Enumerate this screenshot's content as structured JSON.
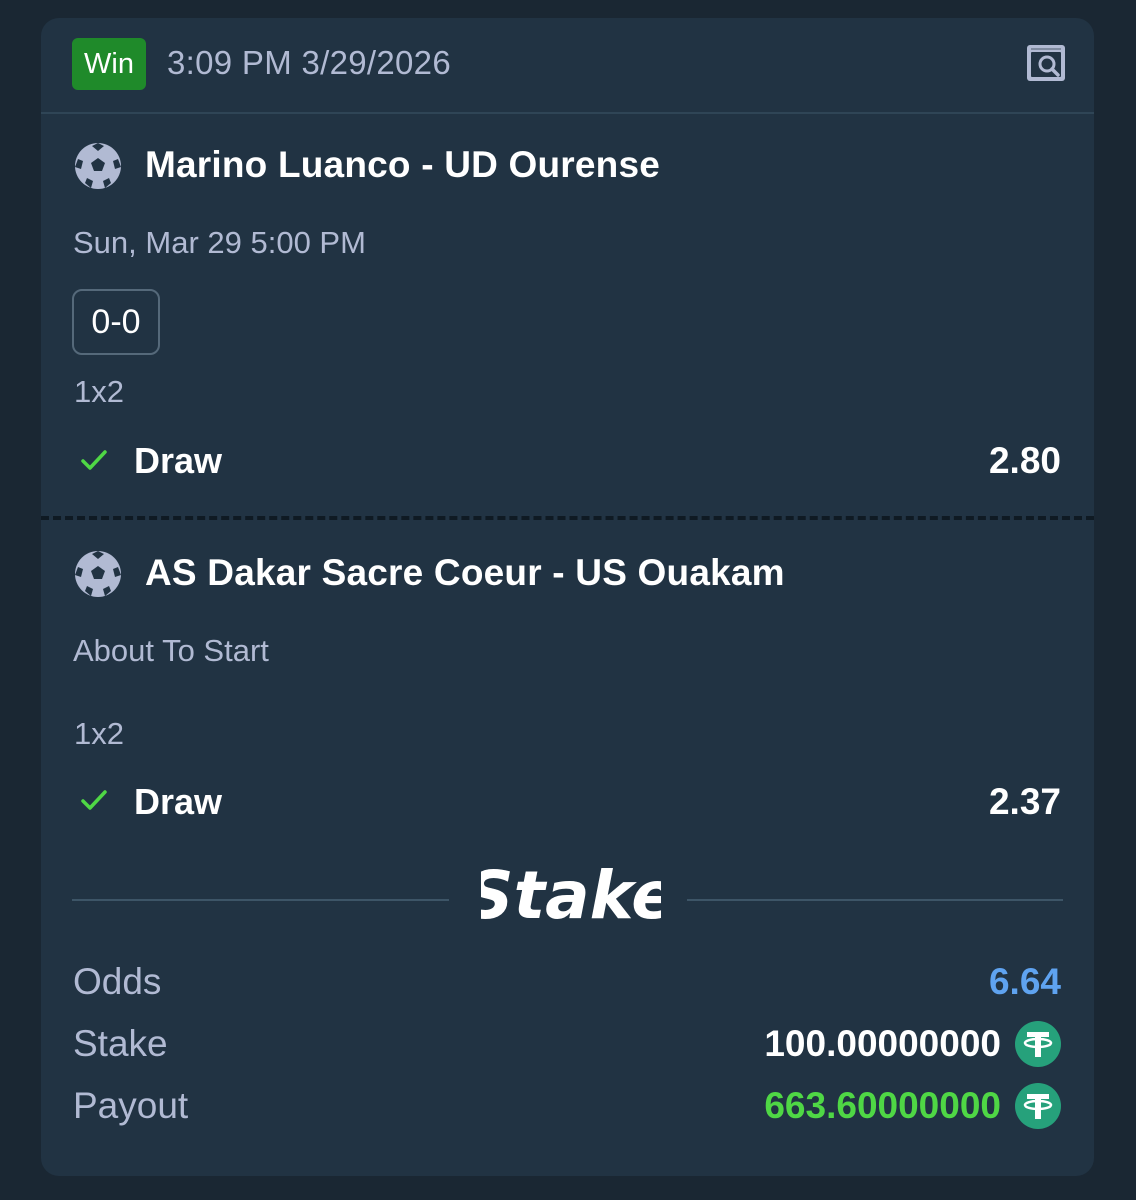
{
  "bet": {
    "status_badge": "Win",
    "placed_at": "3:09 PM 3/29/2026",
    "details_icon": "search-receipt-icon"
  },
  "legs": [
    {
      "sport_icon": "soccer-ball-icon",
      "event": "Marino Luanco - UD Ourense",
      "time": "Sun, Mar 29   5:00 PM",
      "score": "0-0",
      "market": "1x2",
      "selection": "Draw",
      "odds": "2.80",
      "result_icon": "check-icon"
    },
    {
      "sport_icon": "soccer-ball-icon",
      "event": "AS Dakar Sacre Coeur - US Ouakam",
      "status": "About To Start",
      "market": "1x2",
      "selection": "Draw",
      "odds": "2.37",
      "result_icon": "check-icon"
    }
  ],
  "brand": {
    "logo_text": "Stake"
  },
  "summary": {
    "odds_label": "Odds",
    "odds_value": "6.64",
    "stake_label": "Stake",
    "stake_value": "100.00000000",
    "payout_label": "Payout",
    "payout_value": "663.60000000",
    "currency_icon": "tether-usdt-icon"
  },
  "colors": {
    "background": "#1a2733",
    "card": "#213343",
    "win_badge": "#1f8a2a",
    "muted_text": "#b1bad3",
    "odds_blue": "#5fa3f0",
    "payout_green": "#4fd745",
    "tether": "#26a17b"
  }
}
